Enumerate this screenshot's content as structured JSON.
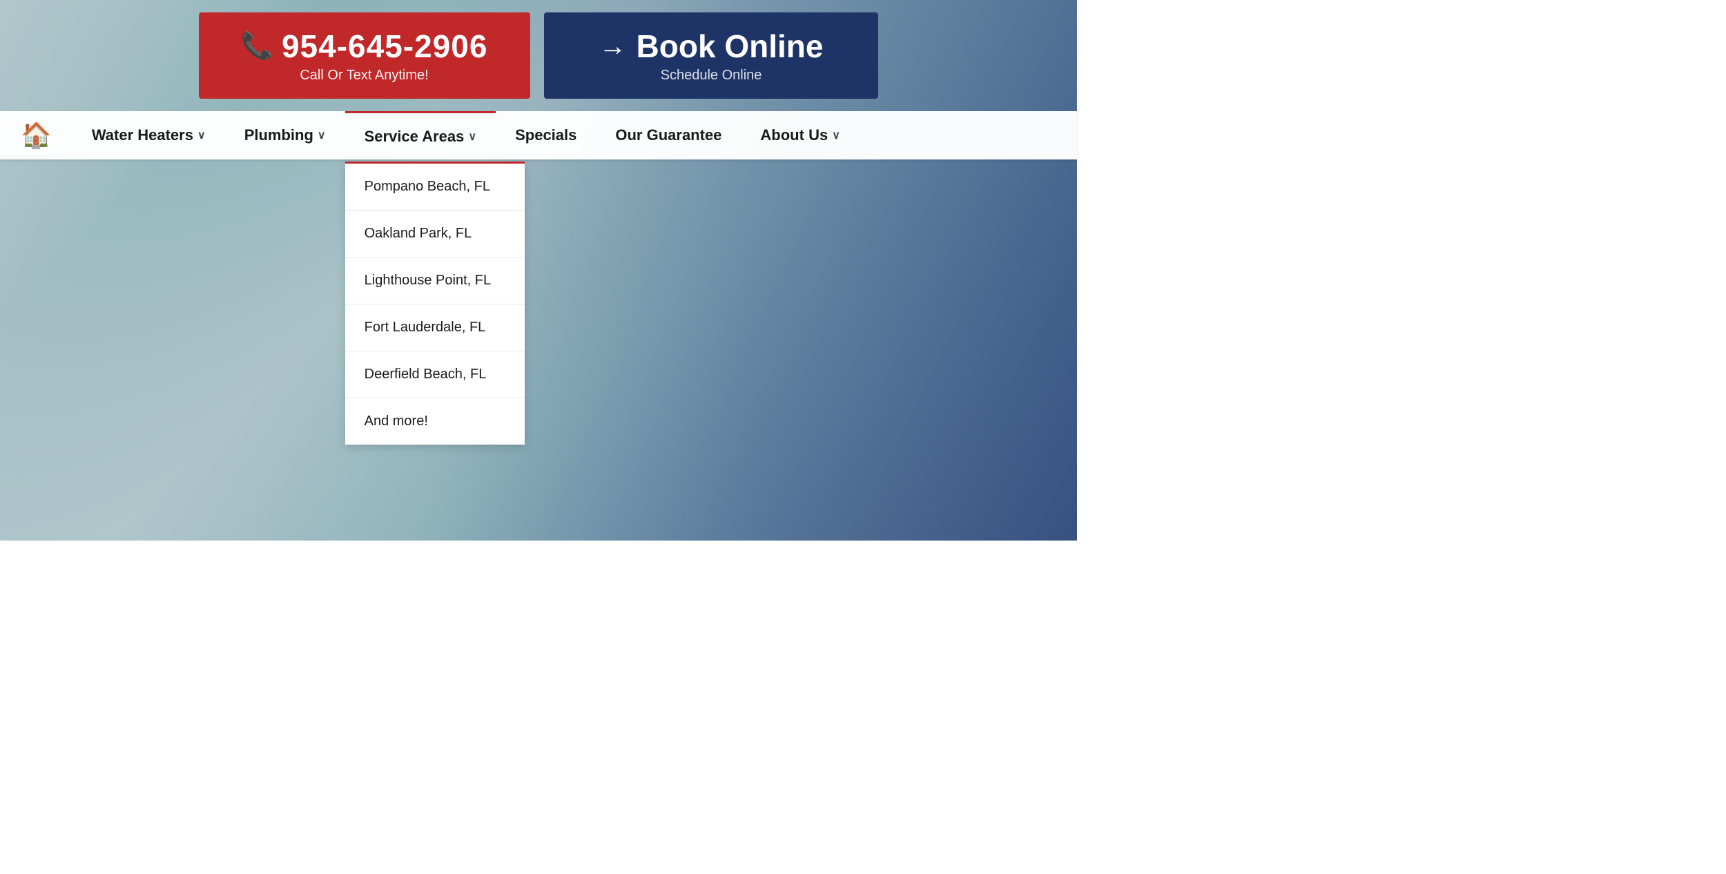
{
  "header": {
    "phone": {
      "icon": "📞",
      "number": "954-645-2906",
      "subtext": "Call Or Text Anytime!"
    },
    "book": {
      "arrow": "→",
      "title": "Book Online",
      "subtext": "Schedule Online"
    }
  },
  "navbar": {
    "home_icon": "🏠",
    "items": [
      {
        "id": "water-heaters",
        "label": "Water Heaters",
        "has_dropdown": true
      },
      {
        "id": "plumbing",
        "label": "Plumbing",
        "has_dropdown": true
      },
      {
        "id": "service-areas",
        "label": "Service Areas",
        "has_dropdown": true,
        "active": true
      },
      {
        "id": "specials",
        "label": "Specials",
        "has_dropdown": false
      },
      {
        "id": "our-guarantee",
        "label": "Our Guarantee",
        "has_dropdown": false
      },
      {
        "id": "about-us",
        "label": "About Us",
        "has_dropdown": true
      }
    ]
  },
  "service_areas_dropdown": {
    "items": [
      "Pompano Beach, FL",
      "Oakland Park, FL",
      "Lighthouse Point, FL",
      "Fort Lauderdale, FL",
      "Deerfield Beach, FL",
      "And more!"
    ]
  },
  "colors": {
    "red": "#c0282a",
    "navy": "#1e3366",
    "white": "#ffffff",
    "nav_bg": "rgba(255,255,255,0.97)",
    "text_dark": "#1a1a1a"
  }
}
